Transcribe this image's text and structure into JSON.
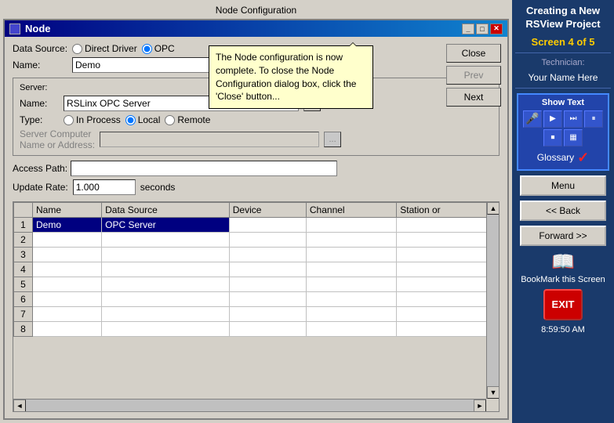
{
  "window": {
    "title": "Node Configuration",
    "node_title": "Node"
  },
  "callout": {
    "text": "The Node configuration is now complete.  To close the Node Configuration dialog box, click the 'Close' button..."
  },
  "buttons": {
    "close": "Close",
    "prev": "Prev",
    "next": "Next",
    "ellipsis": "...",
    "menu": "Menu",
    "back": "<< Back",
    "forward": "Forward >>",
    "bookmark": "BookMark this Screen",
    "exit": "EXIT"
  },
  "form": {
    "data_source_label": "Data Source:",
    "direct_driver": "Direct Driver",
    "opc": "OPC",
    "name_label": "Name:",
    "name_value": "Demo",
    "server_label": "Server:",
    "server_name_label": "Name:",
    "server_name_value": "RSLinx OPC Server",
    "type_label": "Type:",
    "in_process": "In Process",
    "local": "Local",
    "remote": "Remote",
    "server_computer_label": "Server Computer",
    "name_or_address_label": "Name or Address:",
    "access_path_label": "Access Path:",
    "access_path_value": "",
    "update_rate_label": "Update Rate:",
    "update_rate_value": "1.000",
    "seconds_label": "seconds"
  },
  "table": {
    "columns": [
      "Name",
      "Data Source",
      "Device",
      "Channel",
      "Station or"
    ],
    "rows": [
      {
        "num": 1,
        "name": "Demo",
        "data_source": "OPC Server",
        "device": "",
        "channel": "",
        "station": ""
      },
      {
        "num": 2,
        "name": "",
        "data_source": "",
        "device": "",
        "channel": "",
        "station": ""
      },
      {
        "num": 3,
        "name": "",
        "data_source": "",
        "device": "",
        "channel": "",
        "station": ""
      },
      {
        "num": 4,
        "name": "",
        "data_source": "",
        "device": "",
        "channel": "",
        "station": ""
      },
      {
        "num": 5,
        "name": "",
        "data_source": "",
        "device": "",
        "channel": "",
        "station": ""
      },
      {
        "num": 6,
        "name": "",
        "data_source": "",
        "device": "",
        "channel": "",
        "station": ""
      },
      {
        "num": 7,
        "name": "",
        "data_source": "",
        "device": "",
        "channel": "",
        "station": ""
      },
      {
        "num": 8,
        "name": "",
        "data_source": "",
        "device": "",
        "channel": "",
        "station": ""
      }
    ]
  },
  "right_panel": {
    "title": "Creating a New RSView Project",
    "screen_info": "Screen 4 of 5",
    "technician_label": "Technician:",
    "technician_name": "Your Name Here",
    "show_text_label": "Show Text",
    "glossary_label": "Glossary",
    "time": "8:59:50 AM"
  }
}
